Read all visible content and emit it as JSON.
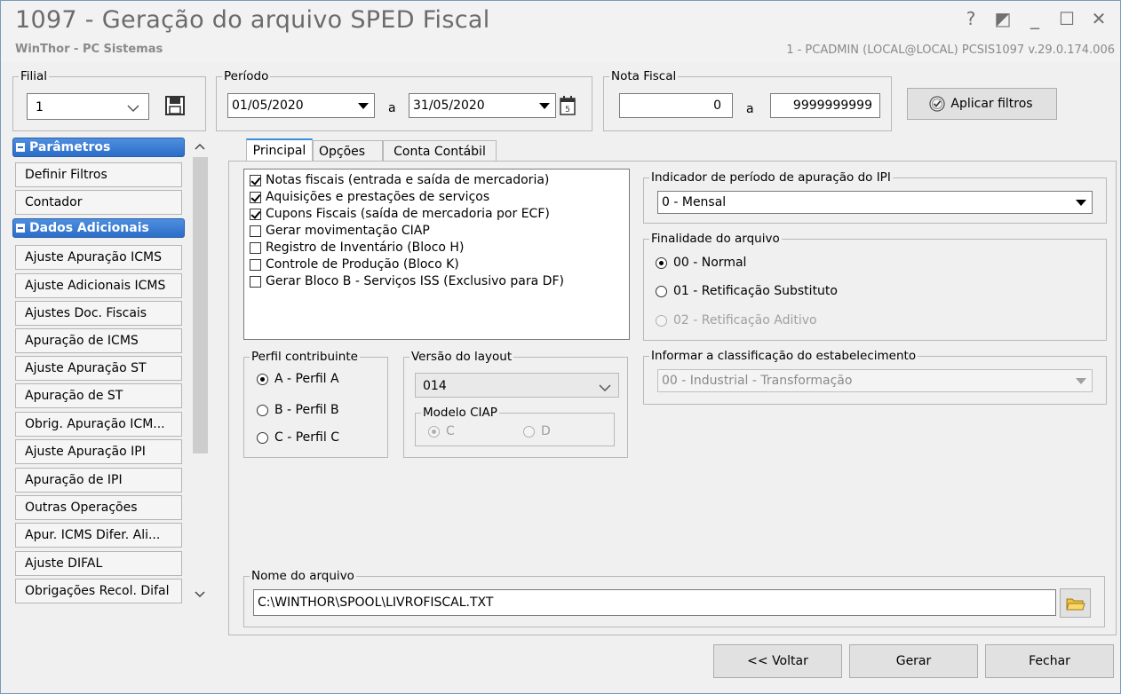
{
  "window": {
    "title": "1097 - Geração do arquivo SPED Fiscal",
    "subtitle": "WinThor - PC Sistemas",
    "user_info": "1 - PCADMIN (LOCAL@LOCAL)  PCSIS1097  v.29.0.174.006",
    "controls": {
      "help": "?",
      "restore": "◩",
      "minimize": "_",
      "maximize": "☐",
      "close": "✕"
    }
  },
  "filial": {
    "legend": "Filial",
    "value": "1"
  },
  "periodo": {
    "legend": "Período",
    "start": "01/05/2020",
    "separator": "a",
    "end": "31/05/2020"
  },
  "nota_fiscal": {
    "legend": "Nota Fiscal",
    "start": "0",
    "separator": "a",
    "end": "9999999999"
  },
  "apply_button": {
    "label": "Aplicar filtros"
  },
  "sidebar": {
    "sections": [
      {
        "title": "Parâmetros",
        "items": [
          "Definir Filtros",
          "Contador"
        ]
      },
      {
        "title": "Dados Adicionais",
        "items": [
          "Ajuste Apuração ICMS",
          "Ajuste Adicionais ICMS",
          "Ajustes Doc. Fiscais",
          "Apuração de ICMS",
          "Ajuste Apuração ST",
          "Apuração de ST",
          "Obrig. Apuração ICM...",
          "Ajuste Apuração IPI",
          "Apuração de IPI",
          "Outras Operações",
          "Apur. ICMS Difer. Ali...",
          "Ajuste DIFAL",
          "Obrigações Recol. Difal"
        ]
      }
    ]
  },
  "tabs": [
    {
      "label": "Principal",
      "active": true
    },
    {
      "label": "Opções",
      "active": false
    },
    {
      "label": "Conta Contábil",
      "active": false
    }
  ],
  "checklist": [
    {
      "label": "Notas fiscais (entrada e saída de mercadoria)",
      "checked": true
    },
    {
      "label": "Aquisições e prestações de serviços",
      "checked": true
    },
    {
      "label": "Cupons Fiscais (saída de mercadoria por ECF)",
      "checked": true
    },
    {
      "label": "Gerar movimentação CIAP",
      "checked": false
    },
    {
      "label": "Registro de Inventário (Bloco H)",
      "checked": false
    },
    {
      "label": "Controle de Produção (Bloco K)",
      "checked": false
    },
    {
      "label": "Gerar Bloco B - Serviços ISS (Exclusivo para DF)",
      "checked": false
    }
  ],
  "perfil": {
    "legend": "Perfil contribuinte",
    "options": [
      {
        "label": "A - Perfil A",
        "selected": true
      },
      {
        "label": "B - Perfil B",
        "selected": false
      },
      {
        "label": "C - Perfil C",
        "selected": false
      }
    ]
  },
  "versao": {
    "legend": "Versão do layout",
    "value": "014"
  },
  "modelo_ciap": {
    "legend": "Modelo CIAP",
    "options": [
      {
        "label": "C",
        "selected": true
      },
      {
        "label": "D",
        "selected": false
      }
    ]
  },
  "ipi": {
    "legend": "Indicador de período de apuração do IPI",
    "value": "0 - Mensal"
  },
  "finalidade": {
    "legend": "Finalidade do arquivo",
    "options": [
      {
        "label": "00 - Normal",
        "selected": true,
        "enabled": true
      },
      {
        "label": "01 - Retificação Substituto",
        "selected": false,
        "enabled": true
      },
      {
        "label": "02 - Retificação Aditivo",
        "selected": false,
        "enabled": false
      }
    ]
  },
  "classificacao": {
    "legend": "Informar a classificação do estabelecimento",
    "value": "00 - Industrial - Transformação"
  },
  "nome_arquivo": {
    "legend": "Nome do arquivo",
    "value": "C:\\WINTHOR\\SPOOL\\LIVROFISCAL.TXT"
  },
  "footer": {
    "back": "<< Voltar",
    "generate": "Gerar",
    "close": "Fechar"
  },
  "colors": {
    "section_header": "#2b6dc8",
    "tab_accent": "#3c8fd6",
    "title_text": "#6b6b6b"
  }
}
